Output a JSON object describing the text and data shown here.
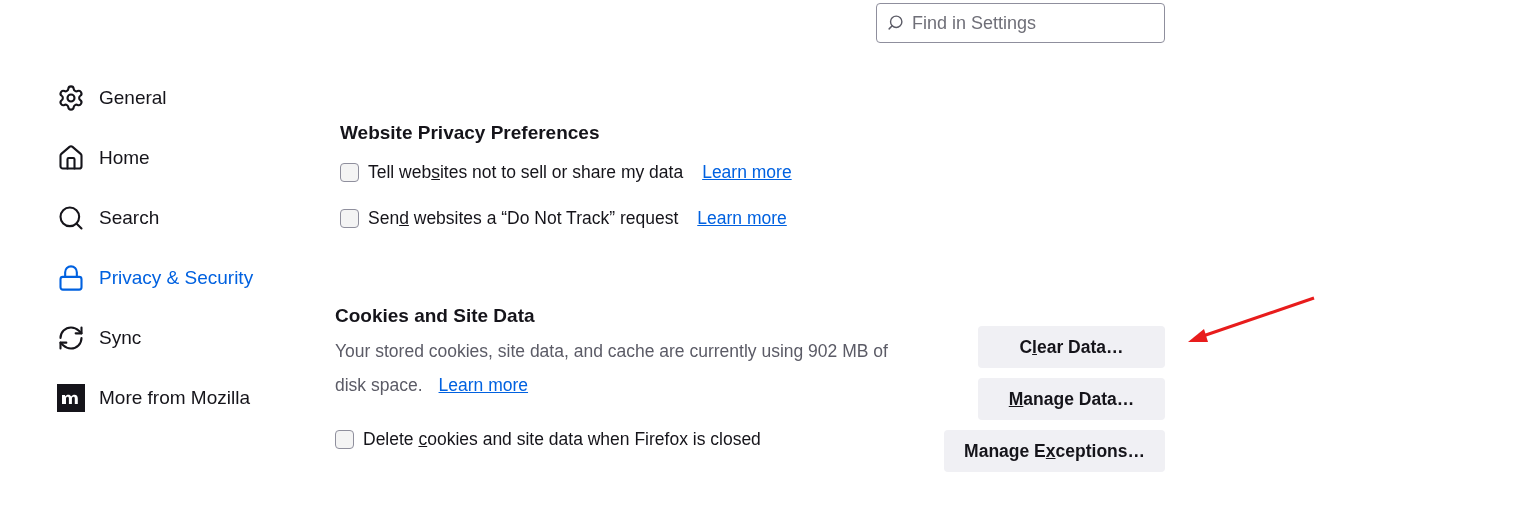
{
  "search": {
    "placeholder": "Find in Settings"
  },
  "sidebar": {
    "items": [
      {
        "label": "General",
        "selected": false
      },
      {
        "label": "Home",
        "selected": false
      },
      {
        "label": "Search",
        "selected": false
      },
      {
        "label": "Privacy & Security",
        "selected": true
      },
      {
        "label": "Sync",
        "selected": false
      },
      {
        "label": "More from Mozilla",
        "selected": false
      }
    ]
  },
  "website_privacy": {
    "title": "Website Privacy Preferences",
    "options": [
      {
        "label": {
          "before": "Tell web",
          "key": "s",
          "after": "ites not to sell or share my data"
        },
        "checked": false,
        "link": "Learn more"
      },
      {
        "label": {
          "before": "Sen",
          "key": "d",
          "after": " websites a “Do Not Track” request"
        },
        "checked": false,
        "link": "Learn more"
      }
    ]
  },
  "cookies": {
    "title": "Cookies and Site Data",
    "description": "Your stored cookies, site data, and cache are currently using 902 MB of disk space.",
    "link": "Learn more",
    "option": {
      "label": {
        "before": "Delete ",
        "key": "c",
        "after": "ookies and site data when Firefox is closed"
      },
      "checked": false
    },
    "buttons": [
      {
        "before": "C",
        "key": "l",
        "after": "ear Data…"
      },
      {
        "key": "M",
        "after": "anage Data…"
      },
      {
        "before": "Manage E",
        "key": "x",
        "after": "ceptions…"
      }
    ]
  }
}
